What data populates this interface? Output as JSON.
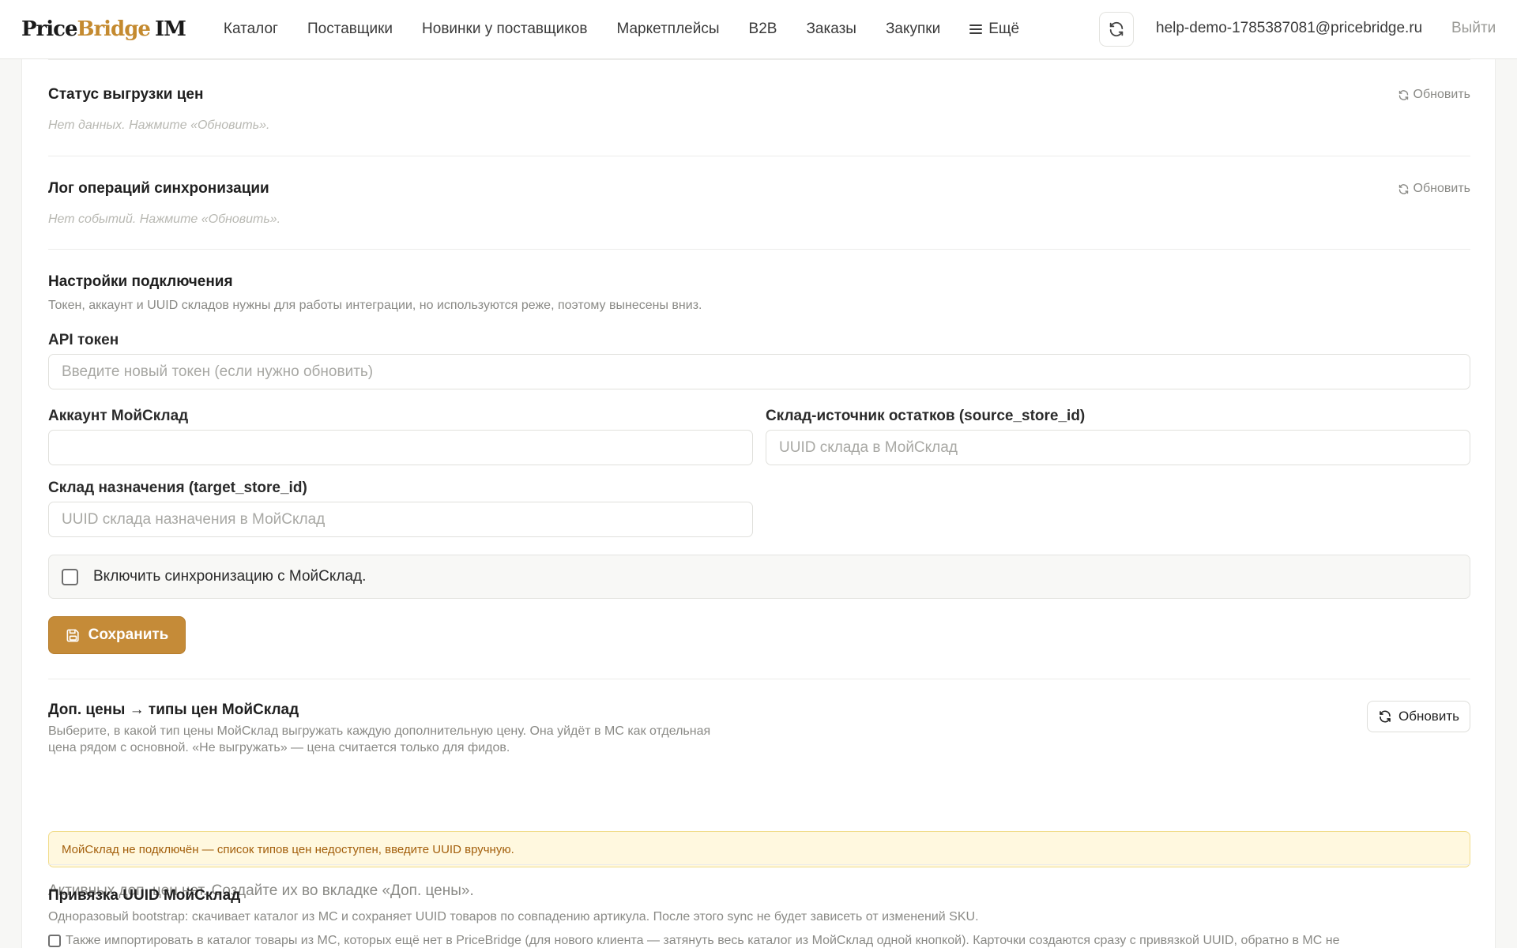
{
  "brand": {
    "part1": "Price",
    "part2": "Bridge",
    "part3": "IM"
  },
  "nav": {
    "items": [
      "Каталог",
      "Поставщики",
      "Новинки у поставщиков",
      "Маркетплейсы",
      "B2B",
      "Заказы",
      "Закупки"
    ],
    "more_label": "Ещё"
  },
  "header": {
    "sync_icon": "refresh-icon",
    "user_email": "help-demo-1785387081@pricebridge.ru",
    "logout_label": "Выйти"
  },
  "price_status": {
    "title": "Статус выгрузки цен",
    "refresh_label": "Обновить",
    "empty_text": "Нет данных. Нажмите «Обновить»."
  },
  "sync_log": {
    "title": "Лог операций синхронизации",
    "refresh_label": "Обновить",
    "empty_text": "Нет событий. Нажмите «Обновить»."
  },
  "connection": {
    "title": "Настройки подключения",
    "description": "Токен, аккаунт и UUID складов нужны для работы интеграции, но используются реже, поэтому вынесены вниз.",
    "api_token_label": "API токен",
    "api_token_placeholder": "Введите новый токен (если нужно обновить)",
    "account_label": "Аккаунт МойСклад",
    "account_value": "",
    "source_store_label": "Склад-источник остатков (source_store_id)",
    "source_store_placeholder": "UUID склада в МойСклад",
    "target_store_label": "Склад назначения (target_store_id)",
    "target_store_placeholder": "UUID склада назначения в МойСклад",
    "enable_sync_label": "Включить синхронизацию с МойСклад.",
    "enable_sync_checked": false,
    "save_label": "Сохранить"
  },
  "extra_prices": {
    "title": "Доп. цены → типы цен МойСклад",
    "description_line1": "Выберите, в какой тип цены МойСклад выгружать каждую дополнительную цену. Она уйдёт в МС как отдельная",
    "description_line2": "цена рядом с основной. «Не выгружать» — цена считается только для фидов.",
    "refresh_label": "Обновить",
    "warning_text": "МойСклад не подключён — список типов цен недоступен, введите UUID вручную.",
    "empty_text": "Активных доп. цен нет. Создайте их во вкладке «Доп. цены»."
  },
  "uuid_binding": {
    "title": "Привязка UUID МойСклад",
    "description": "Одноразовый bootstrap: скачивает каталог из МС и сохраняет UUID товаров по совпадению артикула. После этого sync не будет зависеть от изменений SKU.",
    "partial_line": "Также импортировать в каталог товары из МС, которых ещё нет в PriceBridge (для нового клиента — затянуть весь каталог из МойСклад одной кнопкой). Карточки создаются сразу с привязкой UUID, обратно в МС не"
  },
  "colors": {
    "accent": "#c58b38",
    "brand_gold": "#c48a2f",
    "warning_bg": "#fff8df",
    "warning_text": "#a35f0c"
  }
}
